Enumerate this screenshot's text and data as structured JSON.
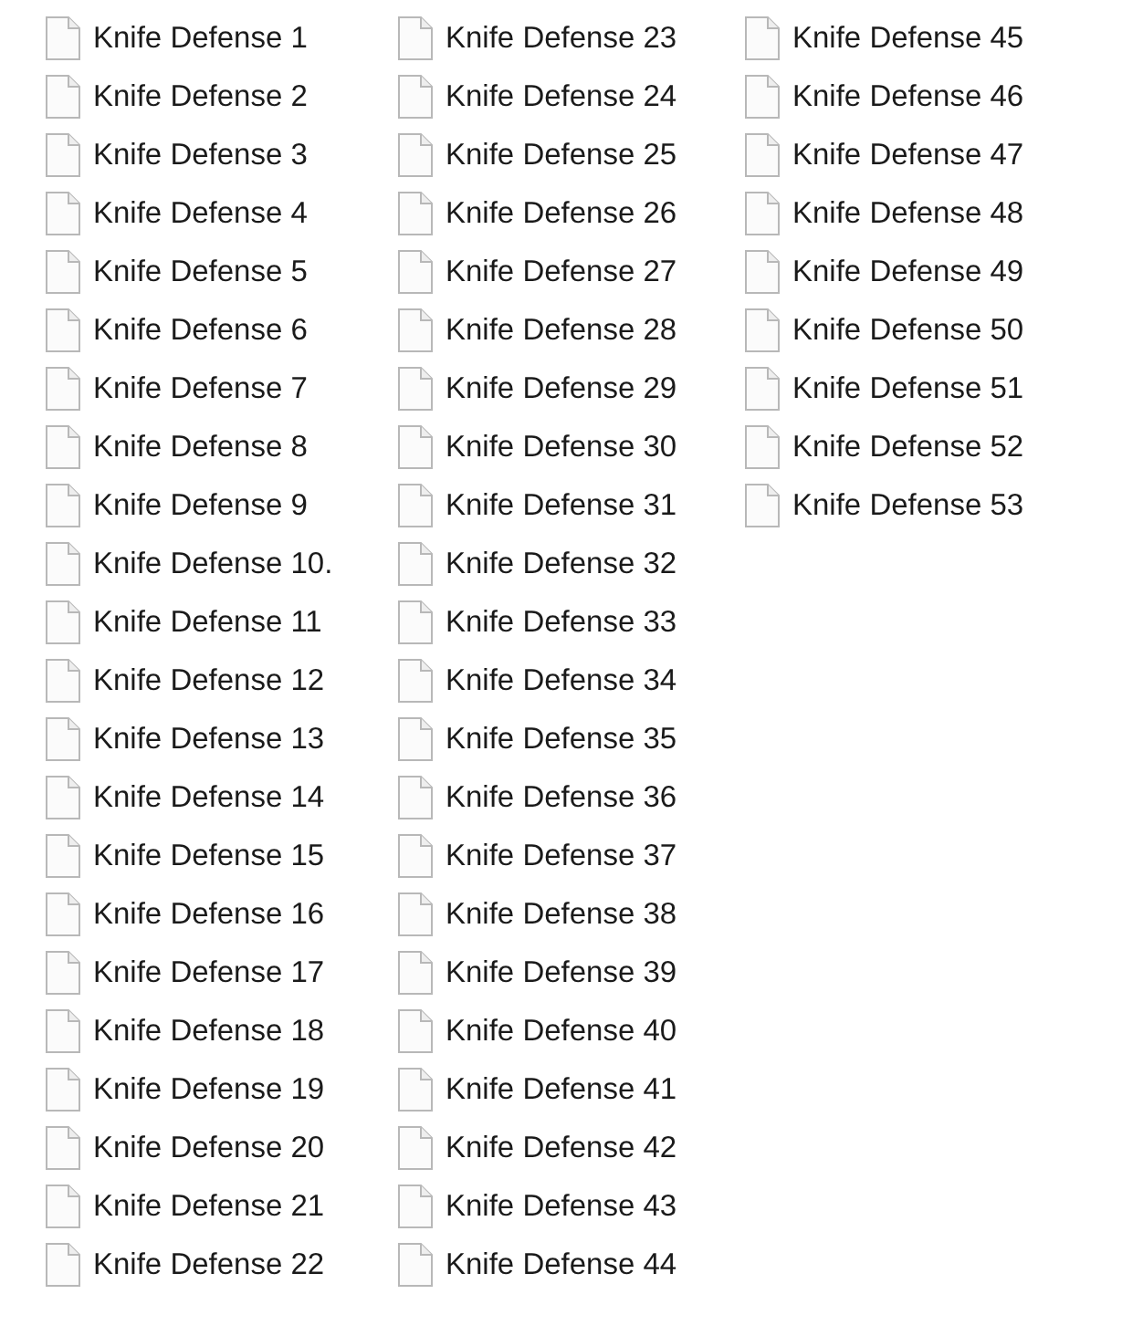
{
  "files": [
    {
      "name": "Knife Defense 1"
    },
    {
      "name": "Knife Defense 2"
    },
    {
      "name": "Knife Defense 3"
    },
    {
      "name": "Knife Defense 4"
    },
    {
      "name": "Knife Defense 5"
    },
    {
      "name": "Knife Defense 6"
    },
    {
      "name": "Knife Defense 7"
    },
    {
      "name": "Knife Defense 8"
    },
    {
      "name": "Knife Defense 9"
    },
    {
      "name": "Knife Defense 10."
    },
    {
      "name": "Knife Defense 11"
    },
    {
      "name": "Knife Defense 12"
    },
    {
      "name": "Knife Defense 13"
    },
    {
      "name": "Knife Defense 14"
    },
    {
      "name": "Knife Defense 15"
    },
    {
      "name": "Knife Defense 16"
    },
    {
      "name": "Knife Defense 17"
    },
    {
      "name": "Knife Defense 18"
    },
    {
      "name": "Knife Defense 19"
    },
    {
      "name": "Knife Defense 20"
    },
    {
      "name": "Knife Defense 21"
    },
    {
      "name": "Knife Defense 22"
    },
    {
      "name": "Knife Defense 23"
    },
    {
      "name": "Knife Defense 24"
    },
    {
      "name": "Knife Defense 25"
    },
    {
      "name": "Knife Defense 26"
    },
    {
      "name": "Knife Defense 27"
    },
    {
      "name": "Knife Defense 28"
    },
    {
      "name": "Knife Defense 29"
    },
    {
      "name": "Knife Defense 30"
    },
    {
      "name": "Knife Defense 31"
    },
    {
      "name": "Knife Defense 32"
    },
    {
      "name": "Knife Defense 33"
    },
    {
      "name": "Knife Defense 34"
    },
    {
      "name": "Knife Defense 35"
    },
    {
      "name": "Knife Defense 36"
    },
    {
      "name": "Knife Defense 37"
    },
    {
      "name": "Knife Defense 38"
    },
    {
      "name": "Knife Defense 39"
    },
    {
      "name": "Knife Defense 40"
    },
    {
      "name": "Knife Defense 41"
    },
    {
      "name": "Knife Defense 42"
    },
    {
      "name": "Knife Defense 43"
    },
    {
      "name": "Knife Defense 44"
    },
    {
      "name": "Knife Defense 45"
    },
    {
      "name": "Knife Defense 46"
    },
    {
      "name": "Knife Defense 47"
    },
    {
      "name": "Knife Defense 48"
    },
    {
      "name": "Knife Defense 49"
    },
    {
      "name": "Knife Defense 50"
    },
    {
      "name": "Knife Defense 51"
    },
    {
      "name": "Knife Defense 52"
    },
    {
      "name": "Knife Defense 53"
    }
  ]
}
